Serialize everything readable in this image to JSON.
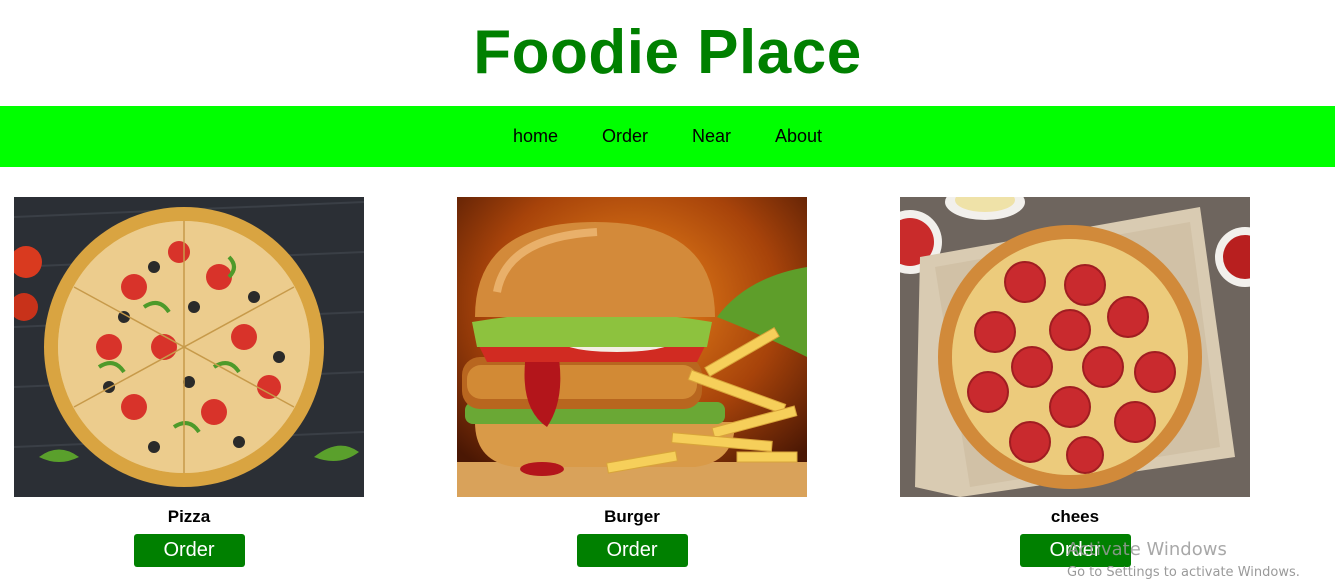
{
  "header": {
    "title": "Foodie Place"
  },
  "nav": {
    "items": [
      {
        "label": "home"
      },
      {
        "label": "Order"
      },
      {
        "label": "Near"
      },
      {
        "label": "About"
      }
    ]
  },
  "products": [
    {
      "name": "Pizza",
      "button": "Order",
      "image": "pizza-photo"
    },
    {
      "name": "Burger",
      "button": "Order",
      "image": "burger-photo"
    },
    {
      "name": "chees",
      "button": "Order",
      "image": "pepperoni-pizza-photo"
    }
  ],
  "watermark": {
    "title": "Activate Windows",
    "subtitle": "Go to Settings to activate Windows."
  },
  "colors": {
    "brand": "#008000",
    "nav_bg": "#00ff00",
    "button_bg": "#008000"
  }
}
